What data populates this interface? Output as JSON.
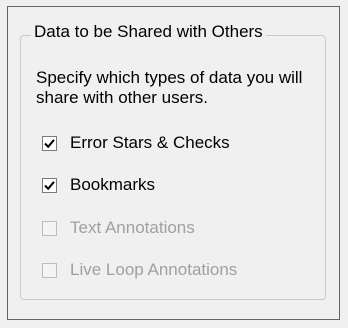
{
  "groupbox": {
    "title": "Data to be Shared with Others",
    "description": "Specify which types of data you will share with other users."
  },
  "options": [
    {
      "label": "Error Stars & Checks",
      "checked": true,
      "enabled": true
    },
    {
      "label": "Bookmarks",
      "checked": true,
      "enabled": true
    },
    {
      "label": "Text Annotations",
      "checked": false,
      "enabled": false
    },
    {
      "label": "Live Loop Annotations",
      "checked": false,
      "enabled": false
    }
  ],
  "colors": {
    "panel_border": "#646464",
    "groupbox_border": "#c9c9c9",
    "disabled_text": "#a0a0a0",
    "background": "#f0f0f0"
  }
}
